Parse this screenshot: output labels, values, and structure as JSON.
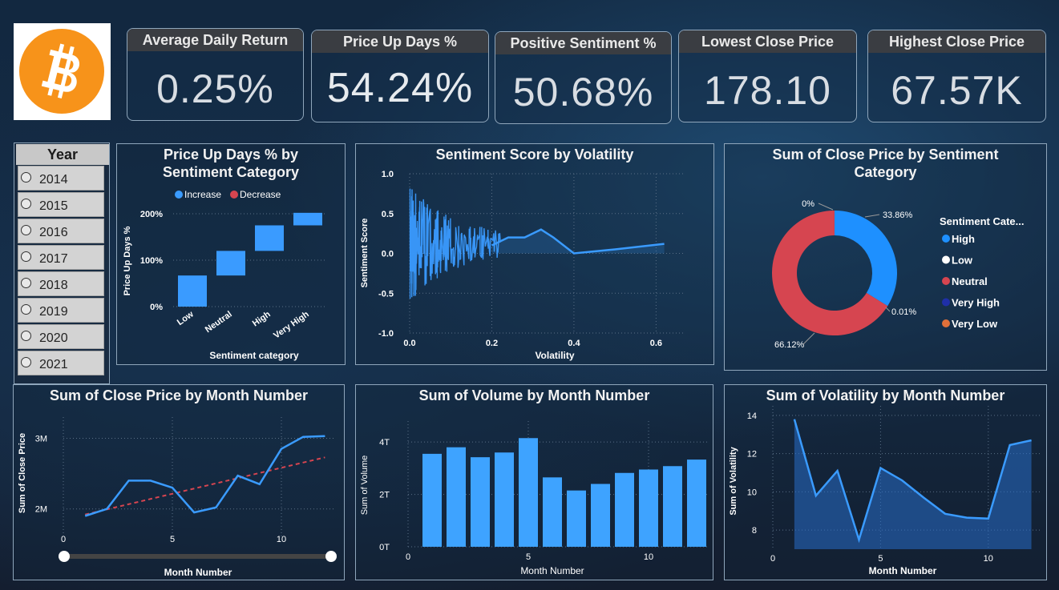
{
  "colors": {
    "accent": "#3a9bff",
    "red": "#d64550",
    "orange": "#f7931a",
    "line": "#3d9cf5"
  },
  "logo": {
    "icon": "bitcoin-icon"
  },
  "kpis": [
    {
      "title": "Average Daily Return",
      "value": "0.25%"
    },
    {
      "title": "Price Up Days %",
      "value": "54.24%"
    },
    {
      "title": "Positive Sentiment %",
      "value": "50.68%"
    },
    {
      "title": "Lowest Close Price",
      "value": "178.10"
    },
    {
      "title": "Highest Close Price",
      "value": "67.57K"
    }
  ],
  "slicer": {
    "title": "Year",
    "items": [
      "2014",
      "2015",
      "2016",
      "2017",
      "2018",
      "2019",
      "2020",
      "2021"
    ]
  },
  "charts": {
    "waterfall": {
      "title_line1": "Price Up Days % by",
      "title_line2": "Sentiment Category",
      "legend": [
        {
          "label": "Increase",
          "color": "#3a9bff"
        },
        {
          "label": "Decrease",
          "color": "#d64550"
        }
      ],
      "xlabel": "Sentiment category",
      "ylabel": "Price Up Days %",
      "yticks": [
        "0%",
        "100%",
        "200%"
      ]
    },
    "scatter_line": {
      "title": "Sentiment Score by Volatility",
      "xlabel": "Volatility",
      "ylabel": "Sentiment Score",
      "yticks": [
        "1.0",
        "0.5",
        "0.0",
        "-0.5",
        "-1.0"
      ],
      "xticks": [
        "0.0",
        "0.2",
        "0.4",
        "0.6"
      ]
    },
    "donut": {
      "title_line1": "Sum of Close Price by Sentiment",
      "title_line2": "Category",
      "legend_title": "Sentiment Cate...",
      "legend": [
        {
          "label": "High",
          "color": "#1e90ff"
        },
        {
          "label": "Low",
          "color": "#ffffff"
        },
        {
          "label": "Neutral",
          "color": "#d64550"
        },
        {
          "label": "Very High",
          "color": "#1f2fa8"
        },
        {
          "label": "Very Low",
          "color": "#e0703a"
        }
      ],
      "labels": {
        "high": "33.86%",
        "zero": "0%",
        "small": "0.01%",
        "neutral": "66.12%"
      }
    },
    "close_month": {
      "title": "Sum of Close Price by Month Number",
      "xlabel": "Month Number",
      "ylabel": "Sum of Close Price",
      "yticks": [
        "2M",
        "3M"
      ],
      "xticks": [
        "0",
        "5",
        "10"
      ]
    },
    "volume_month": {
      "title": "Sum of Volume by Month Number",
      "xlabel": "Month Number",
      "ylabel": "Sum of Volume",
      "yticks": [
        "0T",
        "2T",
        "4T"
      ],
      "xticks": [
        "0",
        "5",
        "10"
      ]
    },
    "vol_month": {
      "title": "Sum of Volatility by Month Number",
      "xlabel": "Month Number",
      "ylabel": "Sum of Volatility",
      "yticks": [
        "8",
        "10",
        "12",
        "14"
      ],
      "xticks": [
        "0",
        "5",
        "10"
      ]
    }
  },
  "chart_data": [
    {
      "type": "bar",
      "subtype": "waterfall",
      "categories": [
        "Low",
        "Neutral",
        "High",
        "Very High"
      ],
      "values": [
        67,
        53,
        55,
        27
      ],
      "ylim": [
        0,
        200
      ],
      "ylabel": "Price Up Days %",
      "xlabel": "Sentiment category"
    },
    {
      "type": "line",
      "x": [
        0.0,
        0.01,
        0.02,
        0.04,
        0.06,
        0.1,
        0.15,
        0.2,
        0.24,
        0.28,
        0.3,
        0.32,
        0.35,
        0.4,
        0.5,
        0.62
      ],
      "y": [
        0.3,
        0.6,
        -0.6,
        0.5,
        -0.4,
        0.2,
        0.15,
        0.1,
        0.2,
        0.2,
        0.25,
        0.3,
        0.2,
        0.0,
        0.05,
        0.12
      ],
      "xlim": [
        0,
        0.65
      ],
      "ylim": [
        -1,
        1
      ],
      "xlabel": "Volatility",
      "ylabel": "Sentiment Score"
    },
    {
      "type": "pie",
      "labels": [
        "High",
        "Low",
        "Neutral",
        "Very High",
        "Very Low"
      ],
      "values": [
        33.86,
        0.0,
        66.12,
        0.01,
        0.0
      ]
    },
    {
      "type": "line",
      "x": [
        1,
        2,
        3,
        4,
        5,
        6,
        7,
        8,
        9,
        10,
        11,
        12
      ],
      "values": [
        1.9,
        2.0,
        2.4,
        2.4,
        2.3,
        1.95,
        2.02,
        2.47,
        2.35,
        2.85,
        3.02,
        3.03
      ],
      "trend": [
        1.92,
        2.73
      ],
      "ylim": [
        1.6,
        3.3
      ],
      "xlim": [
        0,
        12.5
      ],
      "ylabel": "Sum of Close Price (M)",
      "xlabel": "Month Number"
    },
    {
      "type": "bar",
      "x": [
        1,
        2,
        3,
        4,
        5,
        6,
        7,
        8,
        9,
        10,
        11,
        12
      ],
      "values": [
        3.55,
        3.8,
        3.42,
        3.6,
        4.15,
        2.65,
        2.15,
        2.4,
        2.82,
        2.95,
        3.08,
        3.33
      ],
      "ylim": [
        0,
        4.8
      ],
      "xlim": [
        0,
        12.5
      ],
      "ylabel": "Sum of Volume (T)",
      "xlabel": "Month Number"
    },
    {
      "type": "area",
      "x": [
        1,
        2,
        3,
        4,
        5,
        6,
        7,
        8,
        9,
        10,
        11,
        12
      ],
      "values": [
        13.8,
        9.8,
        11.1,
        7.5,
        11.25,
        10.6,
        9.7,
        8.85,
        8.65,
        8.6,
        12.45,
        12.7
      ],
      "ylim": [
        7,
        14.5
      ],
      "xlim": [
        0,
        12.5
      ],
      "ylabel": "Sum of Volatility",
      "xlabel": "Month Number"
    }
  ]
}
